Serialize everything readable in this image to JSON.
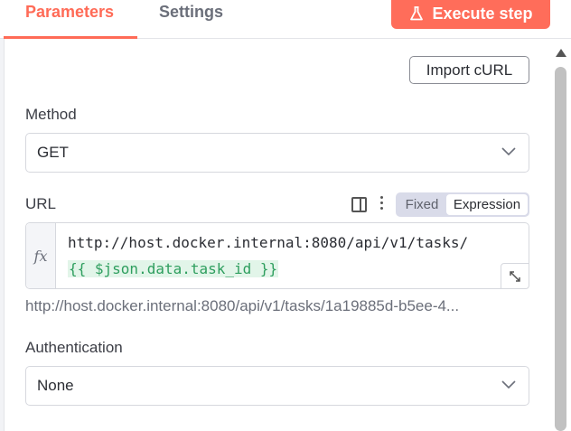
{
  "tabs": {
    "parameters": "Parameters",
    "settings": "Settings"
  },
  "actions": {
    "execute_label": "Execute step",
    "import_curl_label": "Import cURL"
  },
  "fields": {
    "method": {
      "label": "Method",
      "value": "GET"
    },
    "url": {
      "label": "URL",
      "mode_fixed": "Fixed",
      "mode_expression": "Expression",
      "expression_line1": "http://host.docker.internal:8080/api/v1/tasks/",
      "expression_line2": "{{ $json.data.task_id }}",
      "fx_label": "fx",
      "resolved": "http://host.docker.internal:8080/api/v1/tasks/1a19885d-b5ee-4..."
    },
    "authentication": {
      "label": "Authentication",
      "value": "None"
    }
  },
  "colors": {
    "accent": "#ff6d5a",
    "expression_green": "#2e9e5e"
  }
}
